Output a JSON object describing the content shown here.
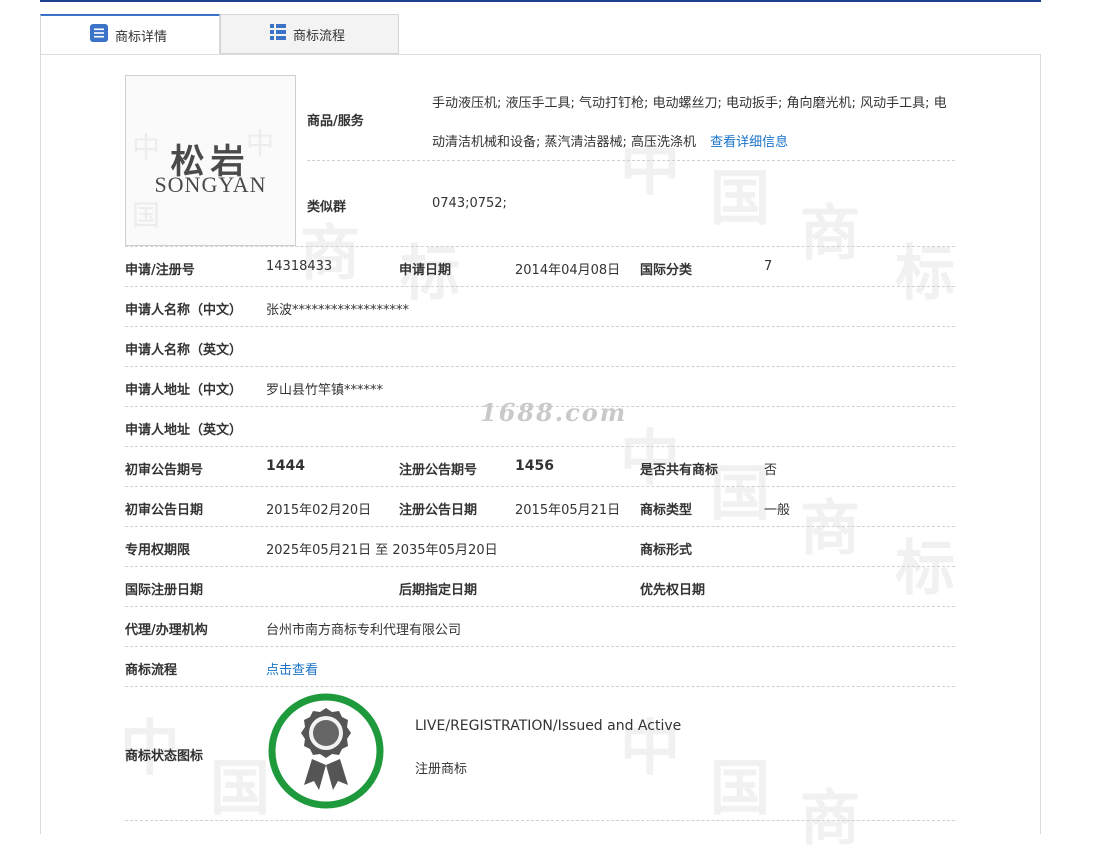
{
  "tabs": [
    {
      "label": "商标详情",
      "icon": "list-doc-icon",
      "active": true
    },
    {
      "label": "商标流程",
      "icon": "grid-list-icon",
      "active": false
    }
  ],
  "watermark": {
    "text": "1688.com",
    "glyphs": [
      "中",
      "国",
      "商",
      "标"
    ]
  },
  "logo": {
    "cn": "松岩",
    "en": "SONGYAN"
  },
  "goods": {
    "label": "商品/服务",
    "value": "手动液压机; 液压手工具; 气动打钉枪; 电动螺丝刀; 电动扳手; 角向磨光机; 风动手工具; 电动清洁机械和设备; 蒸汽清洁器械; 高压洗涤机",
    "link": "查看详细信息"
  },
  "similar_group": {
    "label": "类似群",
    "value": "0743;0752;"
  },
  "fields": {
    "reg_no": {
      "label": "申请/注册号",
      "value": "14318433"
    },
    "apply_date": {
      "label": "申请日期",
      "value": "2014年04月08日"
    },
    "intl_class": {
      "label": "国际分类",
      "value": "7"
    },
    "applicant_cn": {
      "label": "申请人名称（中文）",
      "value": "张波******************"
    },
    "applicant_en": {
      "label": "申请人名称（英文）",
      "value": ""
    },
    "address_cn": {
      "label": "申请人地址（中文）",
      "value": "罗山县竹竿镇******"
    },
    "address_en": {
      "label": "申请人地址（英文）",
      "value": ""
    },
    "prelim_no": {
      "label": "初审公告期号",
      "value": "1444"
    },
    "reg_pub_no": {
      "label": "注册公告期号",
      "value": "1456"
    },
    "shared": {
      "label": "是否共有商标",
      "value": "否"
    },
    "prelim_date": {
      "label": "初审公告日期",
      "value": "2015年02月20日"
    },
    "reg_pub_date": {
      "label": "注册公告日期",
      "value": "2015年05月21日"
    },
    "tm_type": {
      "label": "商标类型",
      "value": "一般"
    },
    "term": {
      "label": "专用权期限",
      "value": "2025年05月21日 至 2035年05月20日"
    },
    "tm_form": {
      "label": "商标形式",
      "value": ""
    },
    "intl_reg_date": {
      "label": "国际注册日期",
      "value": ""
    },
    "later_date": {
      "label": "后期指定日期",
      "value": ""
    },
    "priority_date": {
      "label": "优先权日期",
      "value": ""
    },
    "agent": {
      "label": "代理/办理机构",
      "value": "台州市南方商标专利代理有限公司"
    },
    "process": {
      "label": "商标流程",
      "value": "点击查看"
    }
  },
  "status": {
    "label": "商标状态图标",
    "en": "LIVE/REGISTRATION/Issued and Active",
    "cn": "注册商标",
    "icon": "registered-badge-icon",
    "ring_color": "#1e9a3c",
    "medal_color": "#555555"
  },
  "colors": {
    "link": "#1a73c8",
    "tab_accent": "#3b73c8",
    "top_bar": "#1f3f8f"
  }
}
